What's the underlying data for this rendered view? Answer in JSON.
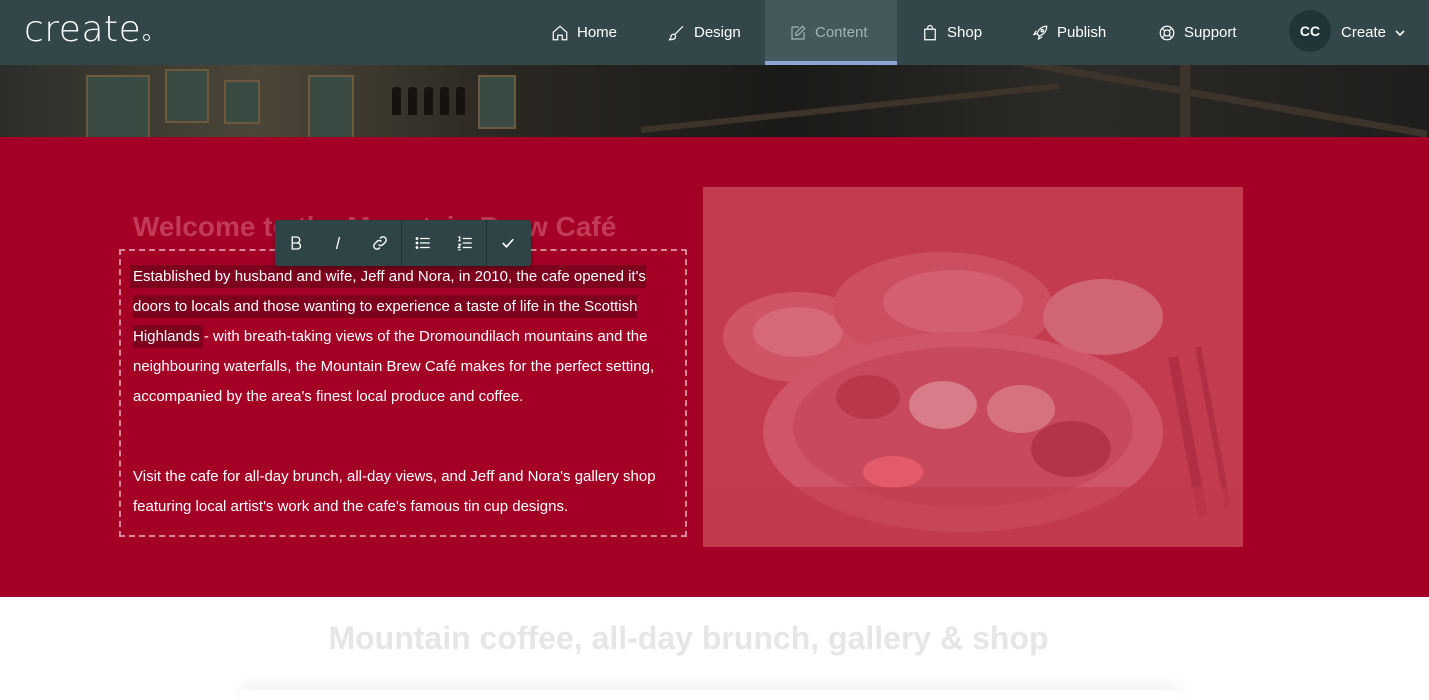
{
  "app": {
    "logo": "create"
  },
  "nav": {
    "items": [
      {
        "label": "Home",
        "icon": "home-icon"
      },
      {
        "label": "Design",
        "icon": "brush-icon"
      },
      {
        "label": "Content",
        "icon": "edit-icon",
        "active": true
      },
      {
        "label": "Shop",
        "icon": "bag-icon"
      },
      {
        "label": "Publish",
        "icon": "rocket-icon"
      },
      {
        "label": "Support",
        "icon": "lifebuoy-icon"
      }
    ],
    "avatar_initials": "CC",
    "create_label": "Create"
  },
  "toolbar": {
    "buttons": [
      "bold-icon",
      "italic-icon",
      "link-icon",
      "bullet-list-icon",
      "numbered-list-icon",
      "check-icon"
    ]
  },
  "section": {
    "heading": "Welcome to the Mountain Brew Café",
    "para1_selected": "Established by husband and wife, Jeff and Nora, in 2010, the cafe opened it's doors to locals and those wanting to experience a taste of life in the Scottish Highlands",
    "para1_rest": " - with breath-taking views of the Dromoundilach mountains and the neighbouring waterfalls, the Mountain Brew Café makes for the perfect setting, accompanied by the area's finest local produce and coffee.",
    "para2": "Visit the cafe for all-day brunch, all-day views, and Jeff and Nora's gallery shop featuring local artist's work and the cafe's famous tin cup designs."
  },
  "lower": {
    "heading": "Mountain coffee, all-day brunch, gallery & shop"
  },
  "colors": {
    "nav_bg": "#33474a",
    "section_red": "#a40026",
    "selection": "#7d001c",
    "active_underline": "#8aa6d8"
  }
}
